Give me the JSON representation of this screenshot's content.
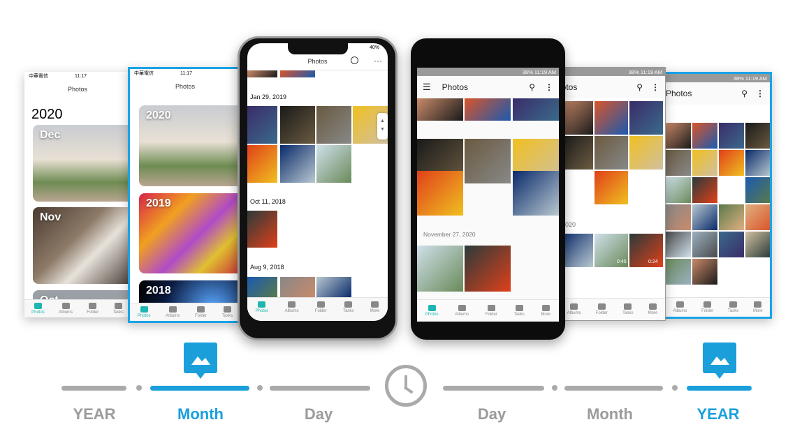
{
  "ios": {
    "carrier": "中華電信",
    "time": "11:17",
    "title": "Photos",
    "year_heading": "2020",
    "month_cards": [
      "Dec",
      "Nov",
      "Oct"
    ],
    "year_cards": [
      "2020",
      "2019",
      "2018"
    ],
    "dates": [
      "Jan 29, 2019",
      "Oct 11, 2018",
      "Aug 9, 2018"
    ],
    "battery": "40%",
    "tabs": [
      "Photos",
      "Albums",
      "Folder",
      "Tasks",
      "More"
    ]
  },
  "android": {
    "status": "38%  11:19 AM",
    "title": "Photos",
    "date_label": "November 27, 2020",
    "partial_date": "2020",
    "durations": [
      "0:45",
      "0:24"
    ],
    "tabs": [
      "Photos",
      "Albums",
      "Folder",
      "Tasks",
      "More"
    ]
  },
  "timeline": {
    "labels": [
      "YEAR",
      "Month",
      "Day",
      "Day",
      "Month",
      "YEAR"
    ],
    "active": [
      "Month",
      "YEAR"
    ],
    "accent": "#1a9fdb",
    "inactive": "#aaaaaa",
    "brand_teal": "#1fb5b0"
  }
}
